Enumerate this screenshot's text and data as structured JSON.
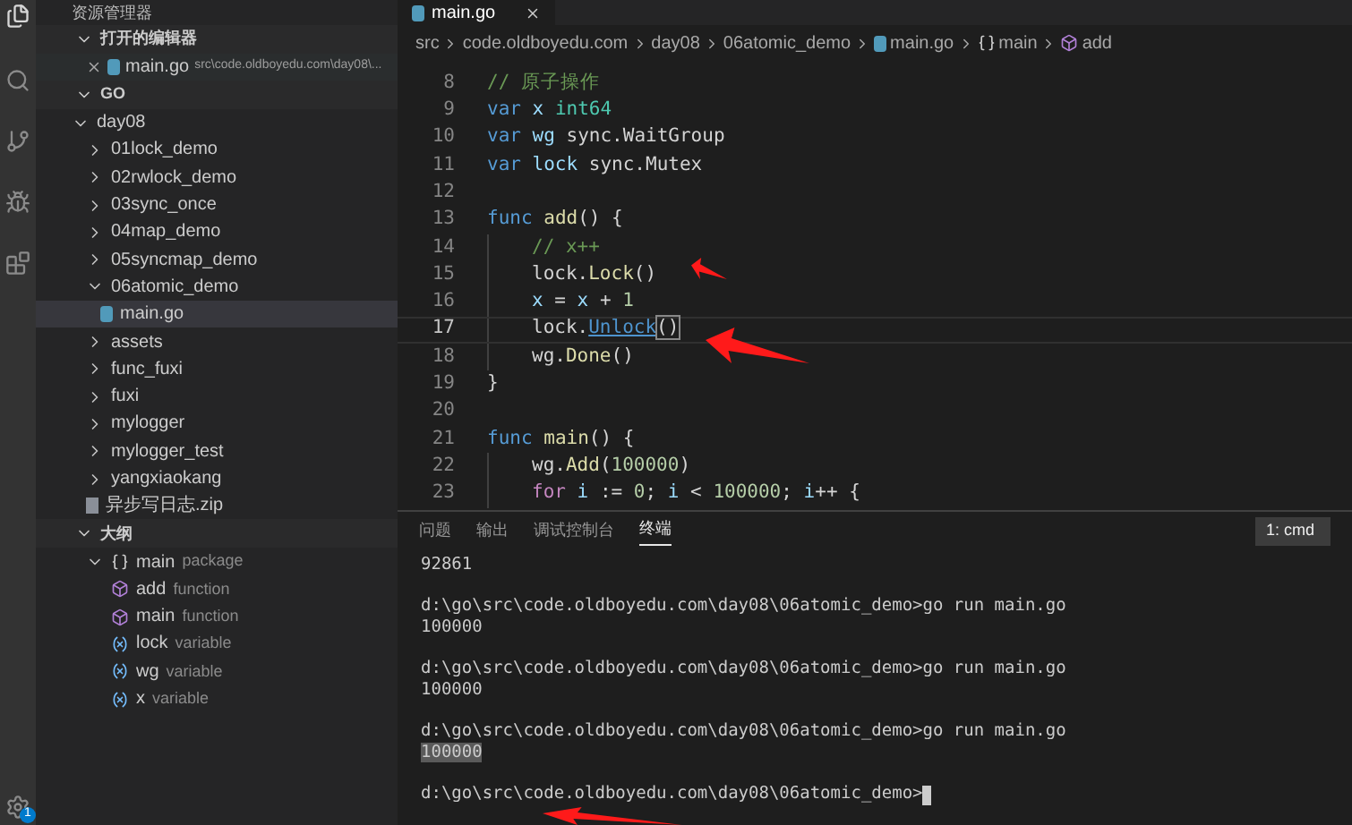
{
  "activity_bar": {
    "settings_badge": "1"
  },
  "sidebar": {
    "title": "资源管理器",
    "open_editors": {
      "title": "打开的编辑器",
      "expanded": true,
      "items": [
        {
          "name": "main.go",
          "path": "src\\code.oldboyedu.com\\day08\\..."
        }
      ]
    },
    "folder": {
      "title": "GO",
      "expanded": true,
      "items": [
        {
          "label": "day08",
          "kind": "folder",
          "expanded": true,
          "selected": false,
          "children": [
            {
              "label": "01lock_demo",
              "kind": "folder",
              "expanded": false,
              "selected": false
            },
            {
              "label": "02rwlock_demo",
              "kind": "folder",
              "expanded": false,
              "selected": false
            },
            {
              "label": "03sync_once",
              "kind": "folder",
              "expanded": false,
              "selected": false
            },
            {
              "label": "04map_demo",
              "kind": "folder",
              "expanded": false,
              "selected": false
            },
            {
              "label": "05syncmap_demo",
              "kind": "folder",
              "expanded": false,
              "selected": false
            },
            {
              "label": "06atomic_demo",
              "kind": "folder",
              "expanded": true,
              "selected": false,
              "children": [
                {
                  "label": "main.go",
                  "kind": "go",
                  "selected": true
                }
              ]
            },
            {
              "label": "assets",
              "kind": "folder",
              "expanded": false,
              "selected": false
            },
            {
              "label": "func_fuxi",
              "kind": "folder",
              "expanded": false,
              "selected": false
            },
            {
              "label": "fuxi",
              "kind": "folder",
              "expanded": false,
              "selected": false
            },
            {
              "label": "mylogger",
              "kind": "folder",
              "expanded": false,
              "selected": false
            },
            {
              "label": "mylogger_test",
              "kind": "folder",
              "expanded": false,
              "selected": false
            },
            {
              "label": "yangxiaokang",
              "kind": "folder",
              "expanded": false,
              "selected": false
            },
            {
              "label": "异步写日志.zip",
              "kind": "zip",
              "selected": false
            }
          ]
        }
      ]
    },
    "outline": {
      "title": "大纲",
      "expanded": true,
      "items": [
        {
          "name": "main",
          "detail": "package",
          "kind": "package",
          "expanded": true,
          "children": [
            {
              "name": "add",
              "detail": "function",
              "kind": "function"
            },
            {
              "name": "main",
              "detail": "function",
              "kind": "function"
            },
            {
              "name": "lock",
              "detail": "variable",
              "kind": "variable"
            },
            {
              "name": "wg",
              "detail": "variable",
              "kind": "variable"
            },
            {
              "name": "x",
              "detail": "variable",
              "kind": "variable"
            }
          ]
        }
      ]
    }
  },
  "editor": {
    "tabs": [
      {
        "label": "main.go",
        "selected": true
      }
    ],
    "breadcrumb": [
      {
        "label": "src",
        "kind": "folder"
      },
      {
        "label": "code.oldboyedu.com",
        "kind": "folder"
      },
      {
        "label": "day08",
        "kind": "folder"
      },
      {
        "label": "06atomic_demo",
        "kind": "folder"
      },
      {
        "label": "main.go",
        "kind": "go"
      },
      {
        "label": "main",
        "kind": "package"
      },
      {
        "label": "add",
        "kind": "function"
      }
    ],
    "lines": [
      {
        "number": "8",
        "indented": false,
        "current": false,
        "tokens": [
          {
            "text": "// 原子操作",
            "kind": "comment"
          }
        ]
      },
      {
        "number": "9",
        "indented": false,
        "current": false,
        "tokens": [
          {
            "text": "var",
            "kind": "keyword"
          },
          {
            "text": " x",
            "kind": "var"
          },
          {
            "text": " int64",
            "kind": "type"
          }
        ]
      },
      {
        "number": "10",
        "indented": false,
        "current": false,
        "tokens": [
          {
            "text": "var",
            "kind": "keyword"
          },
          {
            "text": " wg",
            "kind": "var"
          },
          {
            "text": " sync.WaitGroup",
            "kind": "plain"
          }
        ]
      },
      {
        "number": "11",
        "indented": false,
        "current": false,
        "tokens": [
          {
            "text": "var",
            "kind": "keyword"
          },
          {
            "text": " lock",
            "kind": "var"
          },
          {
            "text": " sync.Mutex",
            "kind": "plain"
          }
        ]
      },
      {
        "number": "12",
        "indented": false,
        "current": false
      },
      {
        "number": "13",
        "indented": false,
        "current": false,
        "tokens": [
          {
            "text": "func",
            "kind": "keyword"
          },
          {
            "text": " add",
            "kind": "func"
          },
          {
            "text": "() {",
            "kind": "plain"
          }
        ]
      },
      {
        "number": "14",
        "indented": true,
        "current": false,
        "tokens": [
          {
            "text": "// x++",
            "kind": "comment"
          }
        ]
      },
      {
        "number": "15",
        "indented": true,
        "current": false,
        "tokens": [
          {
            "text": "lock.",
            "kind": "plain"
          },
          {
            "text": "Lock",
            "kind": "func"
          },
          {
            "text": "()",
            "kind": "plain"
          }
        ]
      },
      {
        "number": "16",
        "indented": true,
        "current": false,
        "tokens": [
          {
            "text": "x",
            "kind": "var"
          },
          {
            "text": " = ",
            "kind": "plain"
          },
          {
            "text": "x",
            "kind": "var"
          },
          {
            "text": " + ",
            "kind": "plain"
          },
          {
            "text": "1",
            "kind": "number"
          }
        ]
      },
      {
        "number": "17",
        "indented": true,
        "current": true,
        "tokens": [
          {
            "text": "lock.",
            "kind": "plain"
          },
          {
            "text": "Unlock",
            "kind": "link"
          },
          {
            "text": "()",
            "kind": "bracket"
          }
        ]
      },
      {
        "number": "18",
        "indented": true,
        "current": false,
        "tokens": [
          {
            "text": "wg.",
            "kind": "plain"
          },
          {
            "text": "Done",
            "kind": "func"
          },
          {
            "text": "()",
            "kind": "plain"
          }
        ]
      },
      {
        "number": "19",
        "indented": false,
        "current": false,
        "tokens": [
          {
            "text": "}",
            "kind": "plain"
          }
        ]
      },
      {
        "number": "20",
        "indented": false,
        "current": false
      },
      {
        "number": "21",
        "indented": false,
        "current": false,
        "tokens": [
          {
            "text": "func",
            "kind": "keyword"
          },
          {
            "text": " main",
            "kind": "func"
          },
          {
            "text": "() {",
            "kind": "plain"
          }
        ]
      },
      {
        "number": "22",
        "indented": true,
        "current": false,
        "tokens": [
          {
            "text": "wg.",
            "kind": "plain"
          },
          {
            "text": "Add",
            "kind": "func"
          },
          {
            "text": "(",
            "kind": "plain"
          },
          {
            "text": "100000",
            "kind": "number"
          },
          {
            "text": ")",
            "kind": "plain"
          }
        ]
      },
      {
        "number": "23",
        "indented": true,
        "current": false,
        "tokens": [
          {
            "text": "for",
            "kind": "control"
          },
          {
            "text": " i",
            "kind": "var"
          },
          {
            "text": " := ",
            "kind": "plain"
          },
          {
            "text": "0",
            "kind": "number"
          },
          {
            "text": "; ",
            "kind": "plain"
          },
          {
            "text": "i",
            "kind": "var"
          },
          {
            "text": " < ",
            "kind": "plain"
          },
          {
            "text": "100000",
            "kind": "number"
          },
          {
            "text": "; ",
            "kind": "plain"
          },
          {
            "text": "i",
            "kind": "var"
          },
          {
            "text": "++ {",
            "kind": "plain"
          }
        ]
      }
    ]
  },
  "panel": {
    "tabs": [
      {
        "label": "问题",
        "selected": false
      },
      {
        "label": "输出",
        "selected": false
      },
      {
        "label": "调试控制台",
        "selected": false
      },
      {
        "label": "终端",
        "selected": true
      }
    ],
    "terminal_select": "1: cmd",
    "entries": [
      {
        "output": "92861",
        "highlighted": false
      },
      {
        "command": "d:\\go\\src\\code.oldboyedu.com\\day08\\06atomic_demo>go run main.go",
        "output": "100000",
        "highlighted": false
      },
      {
        "command": "d:\\go\\src\\code.oldboyedu.com\\day08\\06atomic_demo>go run main.go",
        "output": "100000",
        "highlighted": false
      },
      {
        "command": "d:\\go\\src\\code.oldboyedu.com\\day08\\06atomic_demo>go run main.go",
        "output": "100000",
        "highlighted": true
      },
      {
        "command": "d:\\go\\src\\code.oldboyedu.com\\day08\\06atomic_demo>",
        "cursor": true
      }
    ]
  }
}
